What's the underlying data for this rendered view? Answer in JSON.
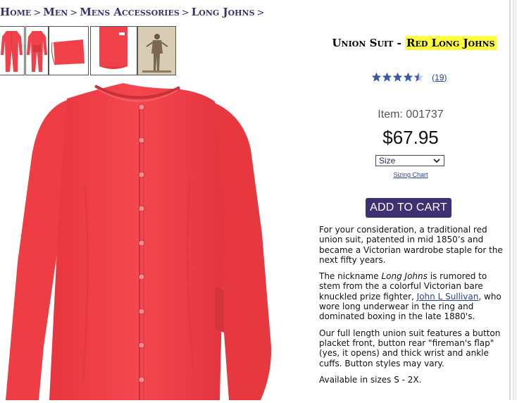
{
  "breadcrumb": {
    "items": [
      "Home",
      "Men",
      "Mens Accessories",
      "Long Johns"
    ],
    "separator": ">"
  },
  "product": {
    "title_part1": "Union Suit - ",
    "title_highlight": "Red Long Johns",
    "rating": 4.5,
    "review_count": "(19)",
    "item_number": "Item: 001737",
    "price": "$67.95",
    "size_select": "Size",
    "size_chart_link": "Sizing Chart",
    "add_to_cart": "ADD TO CART"
  },
  "description": {
    "p1": "For your consideration, a traditional red union suit, patented in mid 1850’s and became a Victorian wardrobe staple for the next fifty years.",
    "p2_before": "The nickname ",
    "p2_italic": "Long Johns",
    "p2_mid": " is rumored to stem from the a colorful Victorian bare knuckled prize fighter, ",
    "p2_link": "John L Sullivan",
    "p2_after": ", who wore long underwear in the ring and dominated boxing in the late 1880's.",
    "p3": "Our full length union suit features a button placket front, button rear \"fireman's flap\" (yes, it opens) and thick wrist and ankle cuffs. Button styles may vary.",
    "p4": "Available in sizes S - 2X."
  },
  "colors": {
    "brand_purple": "#3d3173",
    "link_blue": "#2a3f9a",
    "garment_red": "#f0414a",
    "highlight_yellow": "#ffff3c",
    "star_blue": "#3a5aa8"
  },
  "icons": [
    "star-icon",
    "chevron-down-icon"
  ]
}
